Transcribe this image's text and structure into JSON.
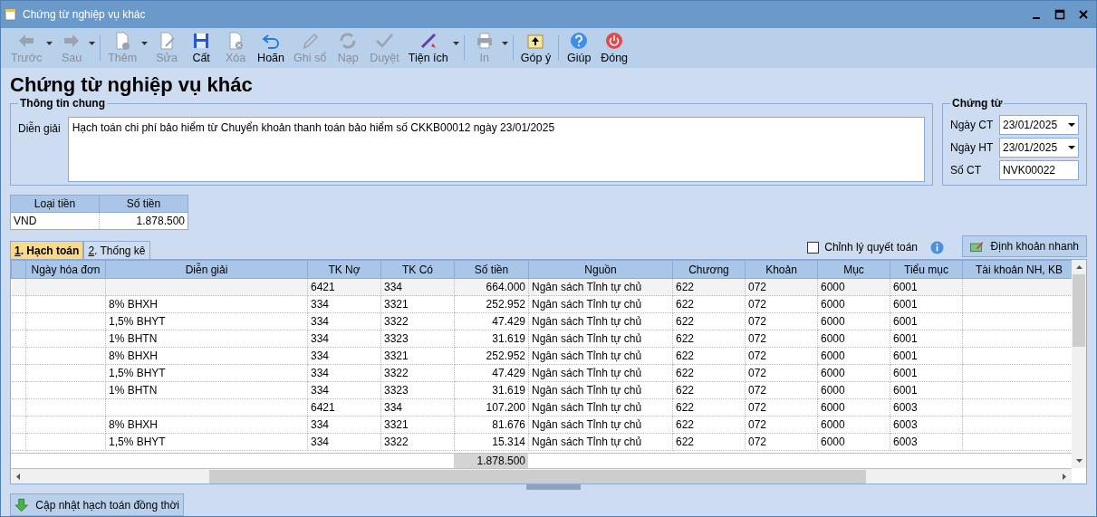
{
  "window": {
    "title": "Chứng từ nghiệp vụ khác"
  },
  "toolbar": [
    {
      "label": "Trước",
      "disabled": true,
      "dropdown": true
    },
    {
      "label": "Sau",
      "disabled": true,
      "dropdown": true
    },
    {
      "label": "Thêm",
      "disabled": true,
      "dropdown": true
    },
    {
      "label": "Sửa",
      "disabled": true,
      "dropdown": false
    },
    {
      "label": "Cất",
      "disabled": false,
      "dropdown": false
    },
    {
      "label": "Xóa",
      "disabled": true,
      "dropdown": false
    },
    {
      "label": "Hoãn",
      "disabled": false,
      "dropdown": false
    },
    {
      "label": "Ghi sổ",
      "disabled": true,
      "dropdown": false
    },
    {
      "label": "Nạp",
      "disabled": true,
      "dropdown": false
    },
    {
      "label": "Duyệt",
      "disabled": true,
      "dropdown": false
    },
    {
      "label": "Tiện ích",
      "disabled": false,
      "dropdown": true
    },
    {
      "label": "In",
      "disabled": true,
      "dropdown": true
    },
    {
      "label": "Góp ý",
      "disabled": false,
      "dropdown": false
    },
    {
      "label": "Giúp",
      "disabled": false,
      "dropdown": false
    },
    {
      "label": "Đóng",
      "disabled": false,
      "dropdown": false
    }
  ],
  "heading": "Chứng từ nghiệp vụ khác",
  "general": {
    "legend": "Thông tin chung",
    "label": "Diễn giải",
    "value": "Hạch toán chi phí bảo hiểm từ Chuyển khoản thanh toán bảo hiểm số CKKB00012 ngày 23/01/2025"
  },
  "voucher": {
    "legend": "Chứng từ",
    "fields": [
      {
        "label": "Ngày CT",
        "value": "23/01/2025",
        "kind": "date"
      },
      {
        "label": "Ngày HT",
        "value": "23/01/2025",
        "kind": "date"
      },
      {
        "label": "Số CT",
        "value": "NVK00022",
        "kind": "text"
      }
    ]
  },
  "currency": {
    "columns": [
      "Loại tiền",
      "Số tiền"
    ],
    "row": [
      "VND",
      "1.878.500"
    ]
  },
  "tabs": [
    {
      "key": "1",
      "label": ". Hạch toán",
      "selected": true
    },
    {
      "key": "2",
      "label": ". Thống kê",
      "selected": false
    }
  ],
  "adjust": {
    "label": "Chỉnh lý quyết toán",
    "checked": false
  },
  "quick_button": "Định khoản nhanh",
  "table": {
    "columns": [
      "Ngày hóa đơn",
      "Diễn giải",
      "TK Nợ",
      "TK Có",
      "Số tiền",
      "Nguồn",
      "Chương",
      "Khoản",
      "Mục",
      "Tiểu mục",
      "Tài khoản NH, KB"
    ],
    "rows": [
      {
        "selected": true,
        "cells": [
          "",
          "",
          "6421",
          "334",
          "664.000",
          "Ngân sách Tỉnh tự chủ",
          "622",
          "072",
          "6000",
          "6001",
          ""
        ]
      },
      {
        "selected": false,
        "cells": [
          "",
          "8% BHXH",
          "334",
          "3321",
          "252.952",
          "Ngân sách Tỉnh tự chủ",
          "622",
          "072",
          "6000",
          "6001",
          ""
        ]
      },
      {
        "selected": false,
        "cells": [
          "",
          "1,5% BHYT",
          "334",
          "3322",
          "47.429",
          "Ngân sách Tỉnh tự chủ",
          "622",
          "072",
          "6000",
          "6001",
          ""
        ]
      },
      {
        "selected": false,
        "cells": [
          "",
          "1% BHTN",
          "334",
          "3323",
          "31.619",
          "Ngân sách Tỉnh tự chủ",
          "622",
          "072",
          "6000",
          "6001",
          ""
        ]
      },
      {
        "selected": false,
        "cells": [
          "",
          "8% BHXH",
          "334",
          "3321",
          "252.952",
          "Ngân sách Tỉnh tự chủ",
          "622",
          "072",
          "6000",
          "6001",
          ""
        ]
      },
      {
        "selected": false,
        "cells": [
          "",
          "1,5% BHYT",
          "334",
          "3322",
          "47.429",
          "Ngân sách Tỉnh tự chủ",
          "622",
          "072",
          "6000",
          "6001",
          ""
        ]
      },
      {
        "selected": false,
        "cells": [
          "",
          "1% BHTN",
          "334",
          "3323",
          "31.619",
          "Ngân sách Tỉnh tự chủ",
          "622",
          "072",
          "6000",
          "6001",
          ""
        ]
      },
      {
        "selected": false,
        "cells": [
          "",
          "",
          "6421",
          "334",
          "107.200",
          "Ngân sách Tỉnh tự chủ",
          "622",
          "072",
          "6000",
          "6003",
          ""
        ]
      },
      {
        "selected": false,
        "cells": [
          "",
          "8% BHXH",
          "334",
          "3321",
          "81.676",
          "Ngân sách Tỉnh tự chủ",
          "622",
          "072",
          "6000",
          "6003",
          ""
        ]
      },
      {
        "selected": false,
        "cells": [
          "",
          "1,5% BHYT",
          "334",
          "3322",
          "15.314",
          "Ngân sách Tỉnh tự chủ",
          "622",
          "072",
          "6000",
          "6003",
          ""
        ]
      }
    ],
    "total": "1.878.500"
  },
  "update_button": "Cập nhật hạch toán đồng thời"
}
